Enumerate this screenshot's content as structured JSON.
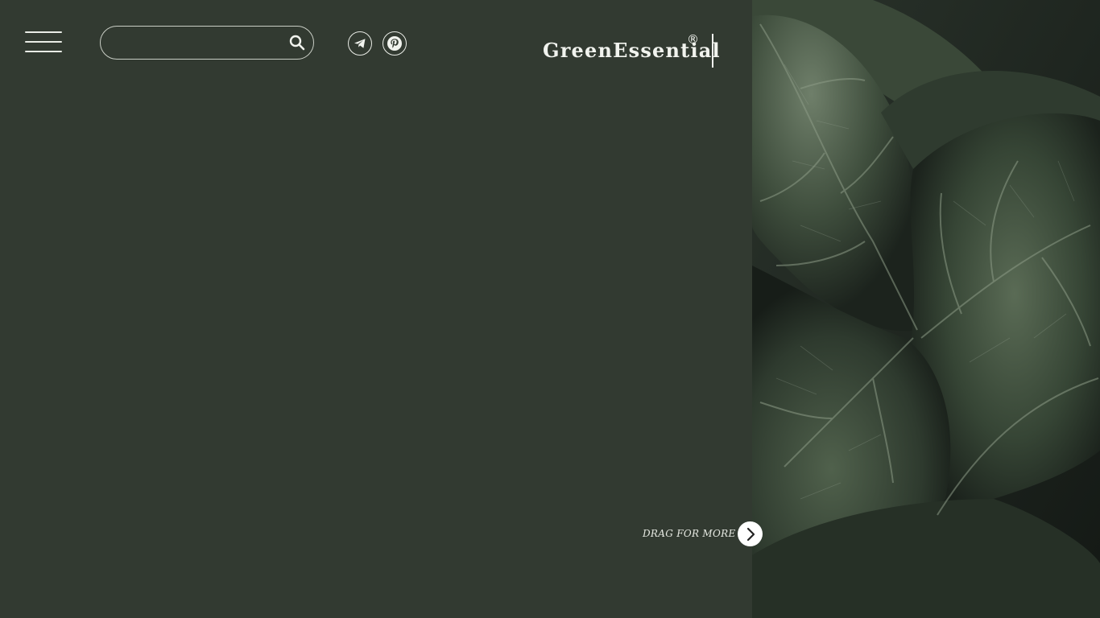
{
  "header": {
    "menu_icon": "hamburger-menu-icon",
    "search": {
      "value": "",
      "placeholder": "",
      "icon": "search-icon"
    },
    "social": [
      {
        "name": "telegram",
        "icon": "telegram-icon"
      },
      {
        "name": "pinterest",
        "icon": "pinterest-icon"
      }
    ],
    "logo_text": "GreenEssential",
    "logo_mark": "®"
  },
  "main": {
    "drag_label": "DRAG FOR MORE",
    "drag_icon": "chevron-right-icon"
  },
  "hero_image": {
    "subject": "fiddle leaf fig leaves"
  },
  "colors": {
    "panel_bg": "#323a31",
    "text": "#f1f3ee",
    "leaf_dark": "#1f2620",
    "leaf_mid": "#3f4f3d",
    "leaf_light": "#6d7f68"
  }
}
